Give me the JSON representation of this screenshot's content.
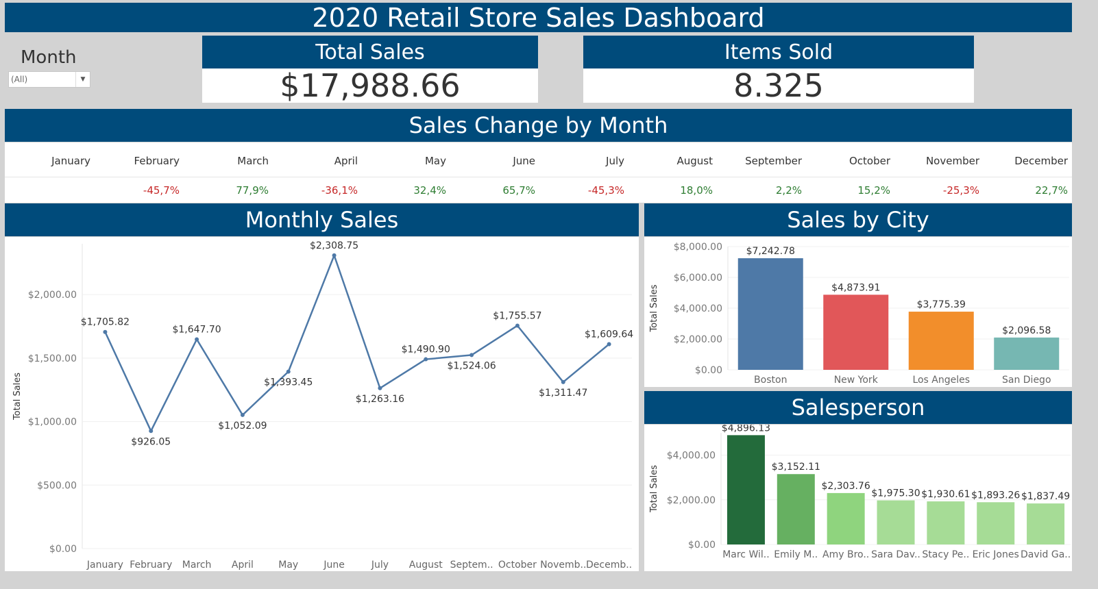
{
  "title": "2020 Retail Store Sales Dashboard",
  "filter": {
    "label": "Month",
    "value": "(All)"
  },
  "kpis": {
    "total_sales": {
      "label": "Total Sales",
      "value": "$17,988.66"
    },
    "items_sold": {
      "label": "Items Sold",
      "value": "8.325"
    }
  },
  "sales_change": {
    "title": "Sales Change by Month",
    "months": [
      "January",
      "February",
      "March",
      "April",
      "May",
      "June",
      "July",
      "August",
      "September",
      "October",
      "November",
      "December"
    ],
    "changes": [
      "",
      "-45,7%",
      "77,9%",
      "-36,1%",
      "32,4%",
      "65,7%",
      "-45,3%",
      "18,0%",
      "2,2%",
      "15,2%",
      "-25,3%",
      "22,7%"
    ]
  },
  "colors": {
    "header": "#004b7b",
    "line": "#4e79a7",
    "positive": "#2e7d32",
    "negative": "#c62828"
  },
  "chart_data": [
    {
      "type": "line",
      "title": "Monthly Sales",
      "ylabel": "Total Sales",
      "xlabel": "",
      "ylim": [
        0,
        2400
      ],
      "yticks": [
        0,
        500,
        1000,
        1500,
        2000
      ],
      "ytick_labels": [
        "$0.00",
        "$500.00",
        "$1,000.00",
        "$1,500.00",
        "$2,000.00"
      ],
      "categories": [
        "January",
        "February",
        "March",
        "April",
        "May",
        "June",
        "July",
        "August",
        "Septem..",
        "October",
        "Novemb..",
        "Decemb.."
      ],
      "values": [
        1705.82,
        926.05,
        1647.7,
        1052.09,
        1393.45,
        2308.75,
        1263.16,
        1490.9,
        1524.06,
        1755.57,
        1311.47,
        1609.64
      ],
      "labels": [
        "$1,705.82",
        "$926.05",
        "$1,647.70",
        "$1,052.09",
        "$1,393.45",
        "$2,308.75",
        "$1,263.16",
        "$1,490.90",
        "$1,524.06",
        "$1,755.57",
        "$1,311.47",
        "$1,609.64"
      ],
      "color": "#4e79a7",
      "grid": true
    },
    {
      "type": "bar",
      "title": "Sales by City",
      "ylabel": "Total Sales",
      "ylim": [
        0,
        8000
      ],
      "yticks": [
        0,
        2000,
        4000,
        6000,
        8000
      ],
      "ytick_labels": [
        "$0.00",
        "$2,000.00",
        "$4,000.00",
        "$6,000.00",
        "$8,000.00"
      ],
      "categories": [
        "Boston",
        "New York",
        "Los Angeles",
        "San Diego"
      ],
      "values": [
        7242.78,
        4873.91,
        3775.39,
        2096.58
      ],
      "labels": [
        "$7,242.78",
        "$4,873.91",
        "$3,775.39",
        "$2,096.58"
      ],
      "colors": [
        "#4e79a7",
        "#e15759",
        "#f28e2b",
        "#76b7b2"
      ]
    },
    {
      "type": "bar",
      "title": "Salesperson",
      "ylabel": "Total Sales",
      "ylim": [
        0,
        5000
      ],
      "yticks": [
        0,
        2000,
        4000
      ],
      "ytick_labels": [
        "$0.00",
        "$2,000.00",
        "$4,000.00"
      ],
      "categories": [
        "Marc Wil..",
        "Emily M..",
        "Amy Bro..",
        "Sara Dav..",
        "Stacy Pe..",
        "Eric Jones",
        "David Ga.."
      ],
      "values": [
        4896.13,
        3152.11,
        2303.76,
        1975.3,
        1930.61,
        1893.26,
        1837.49
      ],
      "labels": [
        "$4,896.13",
        "$3,152.11",
        "$2,303.76",
        "$1,975.30",
        "$1,930.61",
        "$1,893.26",
        "$1,837.49"
      ],
      "colors": [
        "#236b3b",
        "#66b061",
        "#8fd47e",
        "#a6dc96",
        "#a6dc96",
        "#a6dc96",
        "#a6dc96"
      ]
    }
  ]
}
